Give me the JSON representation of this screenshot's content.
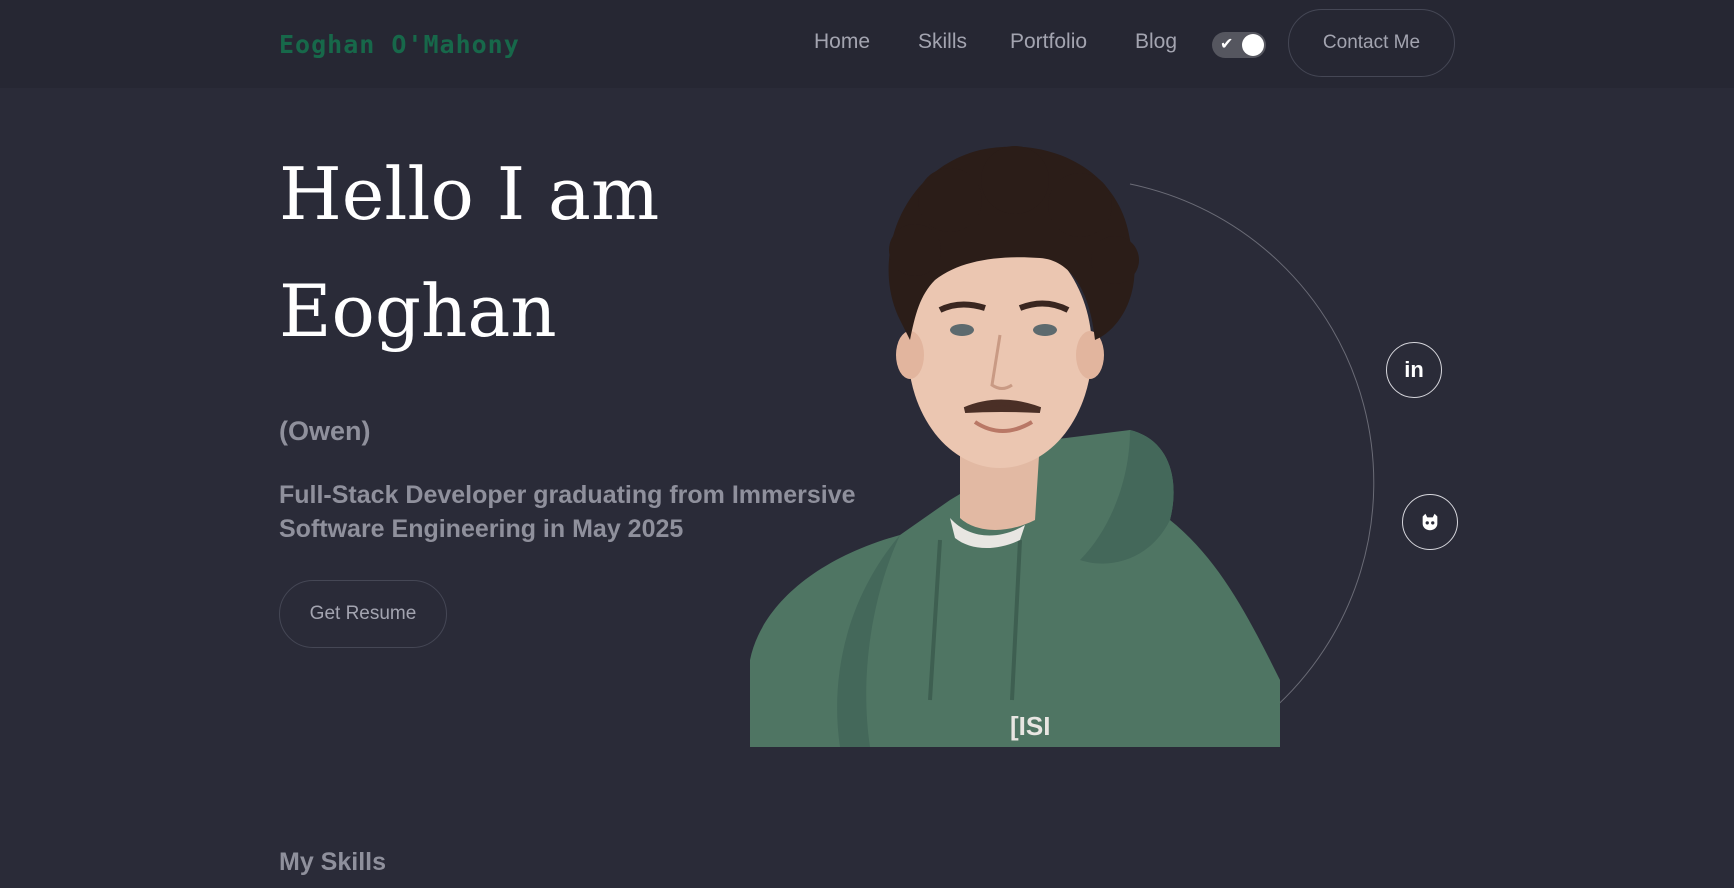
{
  "header": {
    "logo": "Eoghan O'Mahony",
    "nav": [
      {
        "label": "Home"
      },
      {
        "label": "Skills"
      },
      {
        "label": "Portfolio"
      },
      {
        "label": "Blog"
      }
    ],
    "theme_toggle": {
      "state": "on",
      "icon": "check-icon"
    },
    "contact_label": "Contact Me"
  },
  "hero": {
    "greeting_line1": "Hello I am",
    "greeting_line2": "Eoghan",
    "nickname": "(Owen)",
    "tagline": "Full-Stack Developer graduating from Immersive Software Engineering in May 2025",
    "resume_label": "Get Resume",
    "social": {
      "linkedin_icon": "linkedin-icon",
      "linkedin_text": "in",
      "github_icon": "github-icon"
    }
  },
  "skills": {
    "heading": "My Skills"
  },
  "colors": {
    "background": "#2a2b38",
    "header_background": "#262733",
    "logo": "#17684a",
    "muted_text": "#8f909c",
    "hoodie": "#4f7563"
  }
}
